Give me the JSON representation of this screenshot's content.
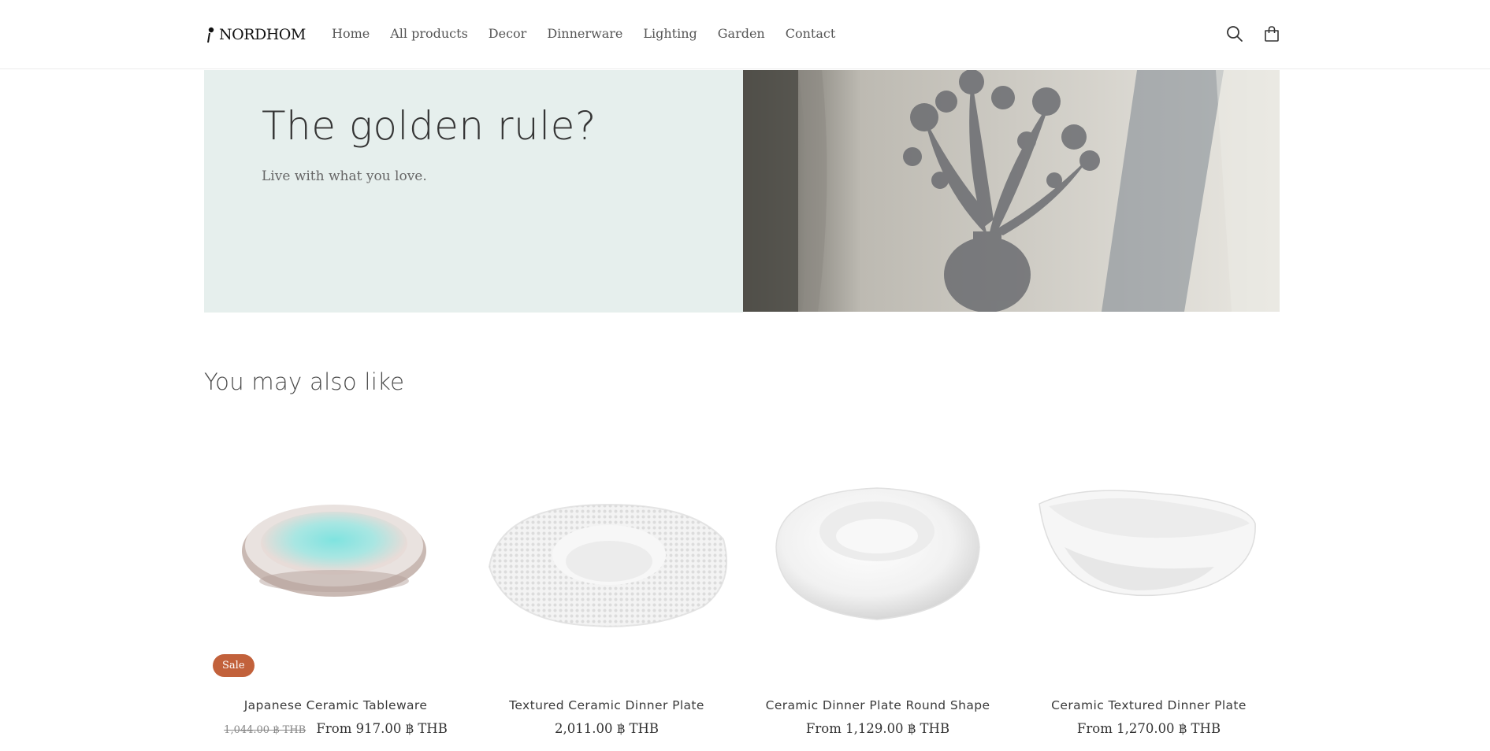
{
  "header": {
    "logo_text": "NORDHOM",
    "nav": [
      {
        "label": "Home"
      },
      {
        "label": "All products"
      },
      {
        "label": "Decor"
      },
      {
        "label": "Dinnerware"
      },
      {
        "label": "Lighting"
      },
      {
        "label": "Garden"
      },
      {
        "label": "Contact"
      }
    ],
    "icons": [
      "search-icon",
      "cart-icon"
    ]
  },
  "hero": {
    "title": "The golden rule?",
    "subtitle": "Live with what you love.",
    "background_color": "#e6efed"
  },
  "recommendations": {
    "title": "You may also like",
    "products": [
      {
        "title": "Japanese Ceramic Tableware",
        "price_old": "1,044.00 ฿ THB",
        "price": "From 917.00 ฿ THB",
        "badge": "Sale"
      },
      {
        "title": "Textured Ceramic Dinner Plate",
        "price": "2,011.00 ฿ THB"
      },
      {
        "title": "Ceramic Dinner Plate Round Shape",
        "price": "From 1,129.00 ฿ THB"
      },
      {
        "title": "Ceramic Textured Dinner Plate",
        "price": "From 1,270.00 ฿ THB"
      }
    ]
  },
  "colors": {
    "sale_badge": "#c2613b",
    "hero_panel": "#e6efed"
  }
}
